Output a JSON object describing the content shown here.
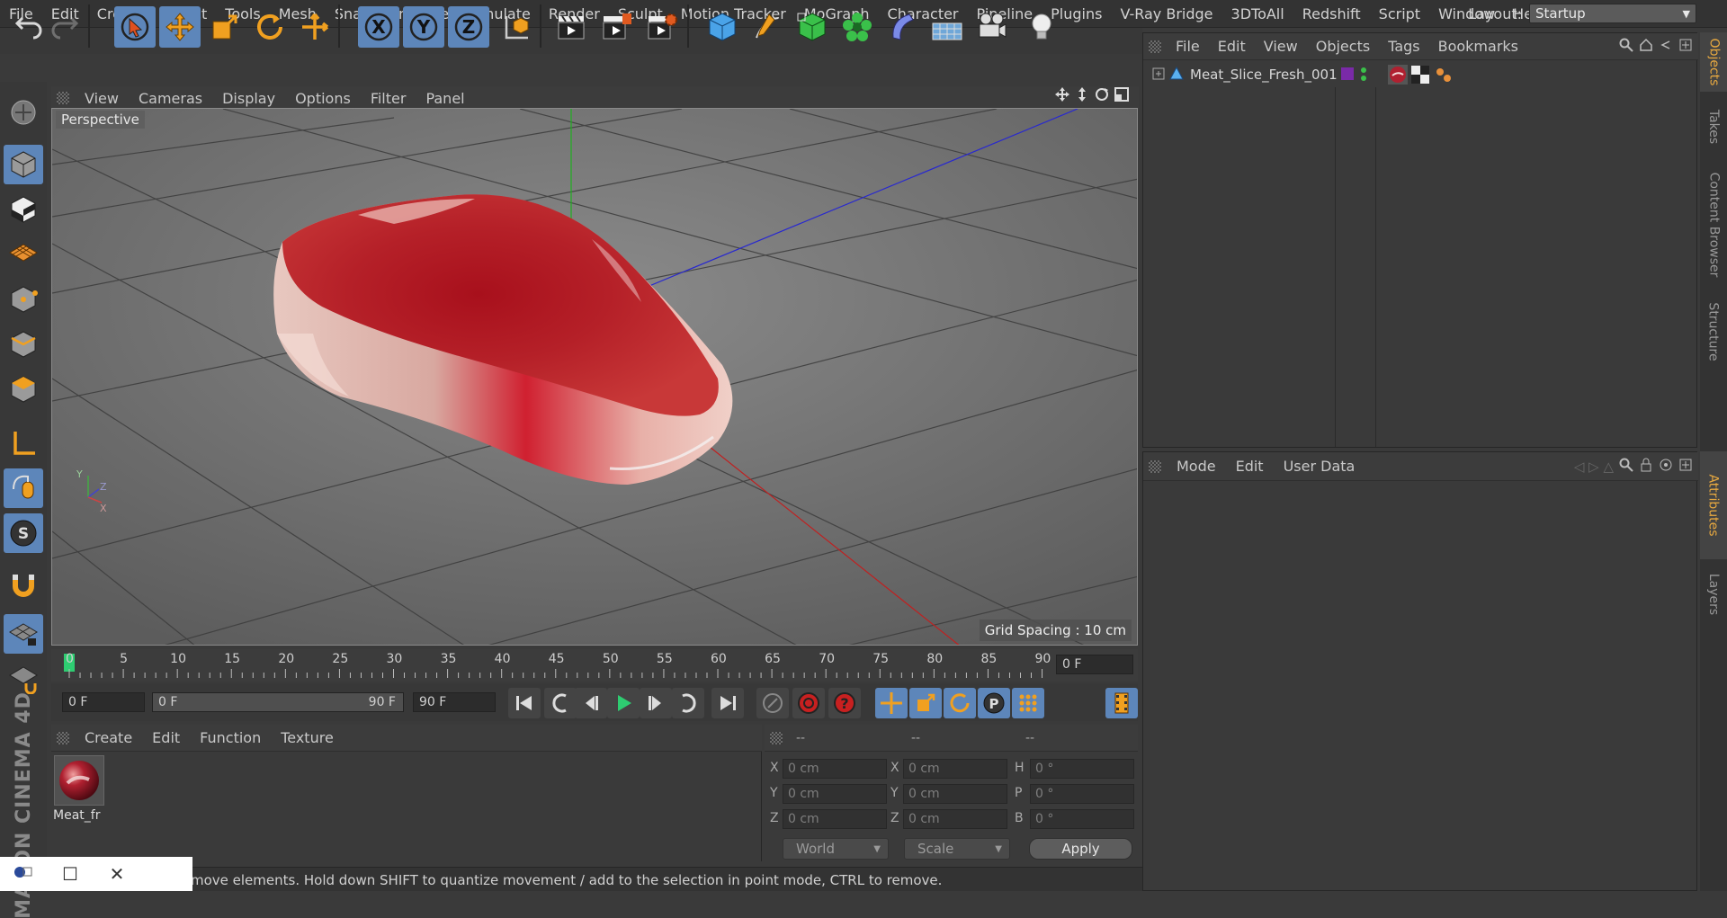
{
  "menubar": {
    "items": [
      "File",
      "Edit",
      "Create",
      "Select",
      "Tools",
      "Mesh",
      "Snap",
      "Animate",
      "Simulate",
      "Render",
      "Sculpt",
      "Motion Tracker",
      "MoGraph",
      "Character",
      "Pipeline",
      "Plugins",
      "V-Ray Bridge",
      "3DToAll",
      "Redshift",
      "Script",
      "Window",
      "Help"
    ],
    "layout_label": "Layout:",
    "layout_value": "Startup"
  },
  "viewport": {
    "menu": [
      "View",
      "Cameras",
      "Display",
      "Options",
      "Filter",
      "Panel"
    ],
    "label": "Perspective",
    "grid_spacing": "Grid Spacing : 10 cm"
  },
  "timeline": {
    "ticks": [
      "0",
      "5",
      "10",
      "15",
      "20",
      "25",
      "30",
      "35",
      "40",
      "45",
      "50",
      "55",
      "60",
      "65",
      "70",
      "75",
      "80",
      "85",
      "90"
    ],
    "current_frame": "0 F"
  },
  "transport": {
    "start": "0 F",
    "range_start": "0 F",
    "range_end": "90 F",
    "end": "90 F"
  },
  "material": {
    "menu": [
      "Create",
      "Edit",
      "Function",
      "Texture"
    ],
    "name": "Meat_fr"
  },
  "coords": {
    "headers": [
      "--",
      "--",
      "--"
    ],
    "rows": [
      {
        "l1": "X",
        "v1": "0 cm",
        "l2": "X",
        "v2": "0 cm",
        "l3": "H",
        "v3": "0 °"
      },
      {
        "l1": "Y",
        "v1": "0 cm",
        "l2": "Y",
        "v2": "0 cm",
        "l3": "P",
        "v3": "0 °"
      },
      {
        "l1": "Z",
        "v1": "0 cm",
        "l2": "Z",
        "v2": "0 cm",
        "l3": "B",
        "v3": "0 °"
      }
    ],
    "world": "World",
    "scale": "Scale",
    "apply": "Apply"
  },
  "status": "move elements. Hold down SHIFT to quantize movement / add to the selection in point mode, CTRL to remove.",
  "logo": "MAXON CINEMA 4D",
  "objects": {
    "menu": [
      "File",
      "Edit",
      "View",
      "Objects",
      "Tags",
      "Bookmarks"
    ],
    "object_name": "Meat_Slice_Fresh_001"
  },
  "attributes": {
    "menu": [
      "Mode",
      "Edit",
      "User Data"
    ]
  },
  "right_tabs": [
    "Objects",
    "Takes",
    "Content Browser",
    "Structure",
    "Attributes",
    "Layers"
  ],
  "colors": {
    "accent": "#5d86ba",
    "orange": "#e8a940",
    "meat": "#b0202a"
  }
}
